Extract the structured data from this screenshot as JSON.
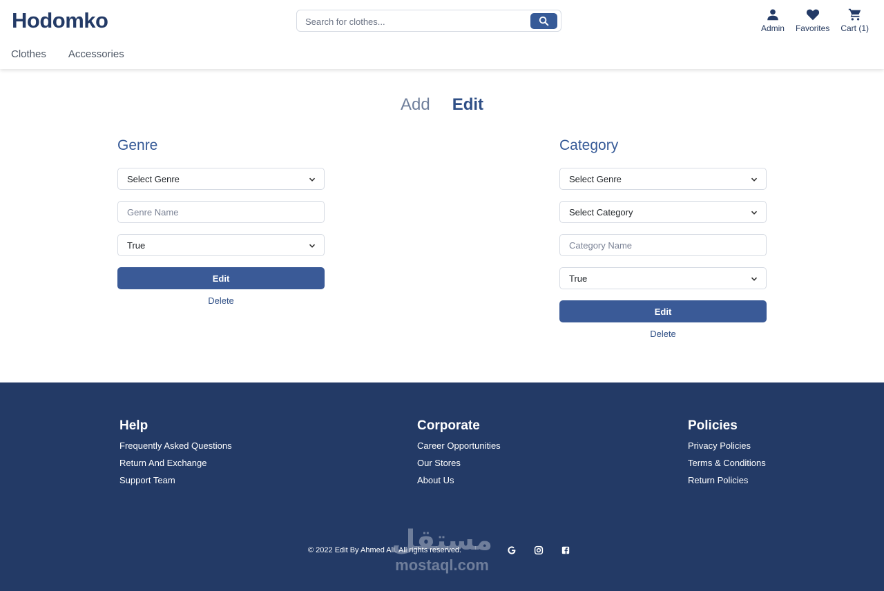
{
  "header": {
    "logo": "Hodomko",
    "search_placeholder": "Search for clothes...",
    "actions": [
      {
        "label": "Admin",
        "icon": "user-icon"
      },
      {
        "label": "Favorites",
        "icon": "heart-icon"
      },
      {
        "label": "Cart (1)",
        "icon": "cart-icon"
      }
    ],
    "nav": [
      "Clothes",
      "Accessories"
    ]
  },
  "tabs": {
    "add": "Add",
    "edit": "Edit",
    "active": "Edit"
  },
  "genre_panel": {
    "title": "Genre",
    "select_genre": "Select Genre",
    "name_placeholder": "Genre Name",
    "status": "True",
    "edit_label": "Edit",
    "delete_label": "Delete"
  },
  "category_panel": {
    "title": "Category",
    "select_genre": "Select Genre",
    "select_category": "Select Category",
    "name_placeholder": "Category Name",
    "status": "True",
    "edit_label": "Edit",
    "delete_label": "Delete"
  },
  "footer": {
    "help": {
      "title": "Help",
      "links": [
        "Frequently Asked Questions",
        "Return And Exchange",
        "Support Team"
      ]
    },
    "corporate": {
      "title": "Corporate",
      "links": [
        "Career Opportunities",
        "Our Stores",
        "About Us"
      ]
    },
    "policies": {
      "title": "Policies",
      "links": [
        "Privacy Policies",
        "Terms & Conditions",
        "Return Policies"
      ]
    },
    "copyright": "© 2022 Edit By Ahmed Ali. All rights reserved.",
    "social_icons": [
      "google-icon",
      "instagram-icon",
      "facebook-icon"
    ],
    "watermark_ar": "مستقل",
    "watermark_lat": "mostaql.com"
  },
  "colors": {
    "brand": "#233a66",
    "accent": "#3a5a97",
    "footer_bg": "#233a66"
  }
}
